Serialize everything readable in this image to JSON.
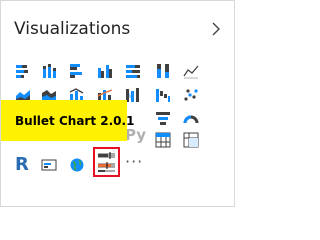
{
  "panel": {
    "title": "Visualizations",
    "collapse_icon": "chevron-right-icon"
  },
  "gallery": {
    "tooltip": "Bullet Chart 2.0.1",
    "r_label": "R",
    "py_label": "Py",
    "more_label": "···",
    "selected_icon": "bullet-chart-icon",
    "colors": {
      "blue": "#118dff",
      "dark": "#404040",
      "orange": "#e66c37",
      "tooltip_bg": "#fff200",
      "selection_border": "#e81123"
    }
  }
}
